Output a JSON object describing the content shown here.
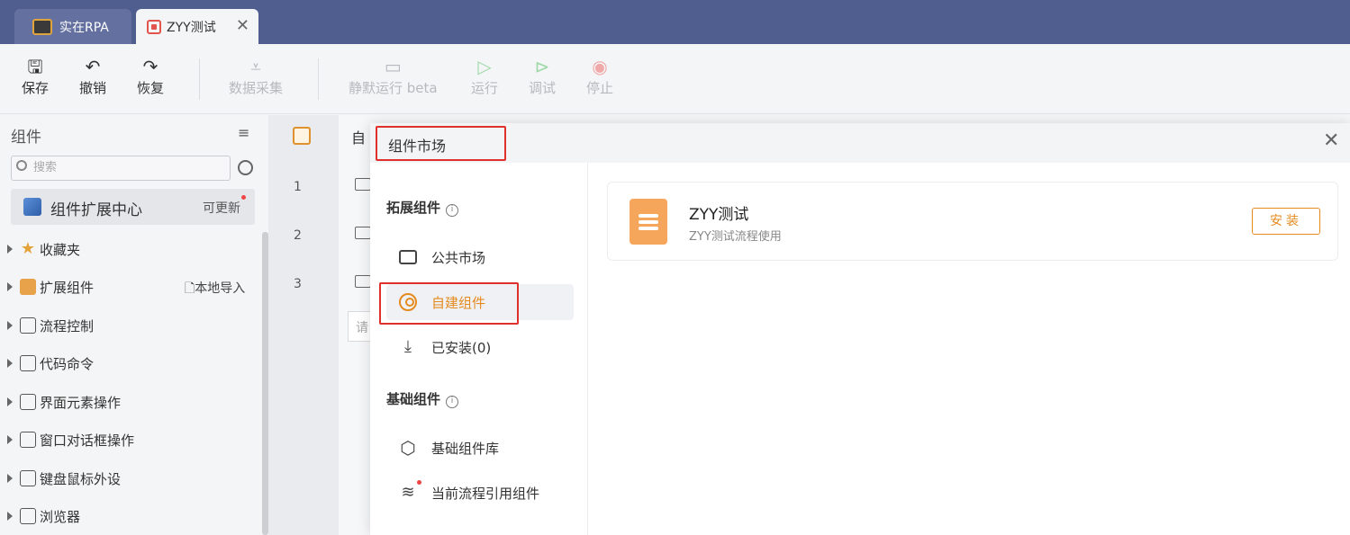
{
  "tabs": [
    {
      "label": "实在RPA"
    },
    {
      "label": "ZYY测试",
      "close": "✕"
    }
  ],
  "toolbar": {
    "save": "保存",
    "undo": "撤销",
    "redo": "恢复",
    "data_collect": "数据采集",
    "silent_run": "静默运行 beta",
    "run": "运行",
    "debug": "调试",
    "stop": "停止"
  },
  "left_panel": {
    "title": "组件",
    "search_placeholder": "搜索",
    "ext_center": "组件扩展中心",
    "update_label": "可更新",
    "local_import": "本地导入",
    "items": [
      "收藏夹",
      "扩展组件",
      "流程控制",
      "代码命令",
      "界面元素操作",
      "窗口对话框操作",
      "键盘鼠标外设",
      "浏览器"
    ]
  },
  "editor": {
    "header": "自",
    "line_numbers": [
      "1",
      "2",
      "3"
    ],
    "input_placeholder": "请"
  },
  "modal": {
    "title": "组件市场",
    "close": "✕",
    "ext_section": "拓展组件",
    "basic_section": "基础组件",
    "nav": {
      "public_market": "公共市场",
      "self_built": "自建组件",
      "installed": "已安装(0)",
      "basic_lib": "基础组件库",
      "current_ref": "当前流程引用组件"
    },
    "card": {
      "title": "ZYY测试",
      "desc": "ZYY测试流程使用",
      "install": "安装"
    }
  },
  "colors": {
    "titlebar": "#4f5d8f",
    "accent": "#e48a1f",
    "highlight": "#e0302c"
  }
}
